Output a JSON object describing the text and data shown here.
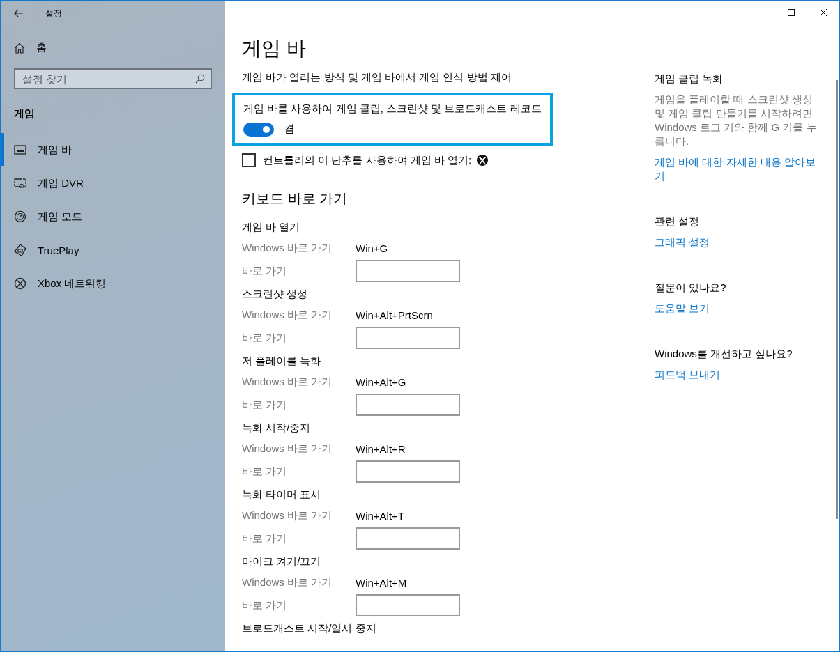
{
  "window": {
    "title": "설정"
  },
  "sidebar": {
    "home": "홈",
    "search": {
      "placeholder": "설정 찾기"
    },
    "section": "게임",
    "items": [
      {
        "label": "게임 바",
        "selected": true
      },
      {
        "label": "게임 DVR",
        "selected": false
      },
      {
        "label": "게임 모드",
        "selected": false
      },
      {
        "label": "TruePlay",
        "selected": false
      },
      {
        "label": "Xbox 네트워킹",
        "selected": false
      }
    ]
  },
  "main": {
    "title": "게임 바",
    "description": "게임 바가 열리는 방식 및 게임 바에서 게임 인식 방법 제어",
    "toggle": {
      "label": "게임 바를 사용하여 게임 클립, 스크린샷 및 브로드캐스트 레코드",
      "on": true,
      "state_text": "켬",
      "focused": true
    },
    "checkbox": {
      "label": "컨트롤러의 이 단추를 사용하여 게임 바 열기:",
      "checked": false
    },
    "shortcuts_title": "키보드 바로 가기",
    "shortcuts": [
      {
        "heading": "게임 바 열기",
        "windows_label": "Windows 바로 가기",
        "windows_value": "Win+G",
        "custom_label": "바로 가기"
      },
      {
        "heading": "스크린샷 생성",
        "windows_label": "Windows 바로 가기",
        "windows_value": "Win+Alt+PrtScrn",
        "custom_label": "바로 가기"
      },
      {
        "heading": "저 플레이를 녹화",
        "windows_label": "Windows 바로 가기",
        "windows_value": "Win+Alt+G",
        "custom_label": "바로 가기"
      },
      {
        "heading": "녹화 시작/중지",
        "windows_label": "Windows 바로 가기",
        "windows_value": "Win+Alt+R",
        "custom_label": "바로 가기"
      },
      {
        "heading": "녹화 타이머 표시",
        "windows_label": "Windows 바로 가기",
        "windows_value": "Win+Alt+T",
        "custom_label": "바로 가기"
      },
      {
        "heading": "마이크 켜기/끄기",
        "windows_label": "Windows 바로 가기",
        "windows_value": "Win+Alt+M",
        "custom_label": "바로 가기"
      },
      {
        "heading": "브로드캐스트 시작/일시 중지"
      }
    ]
  },
  "aside": [
    {
      "heading": "게임 클립 녹화",
      "text": "게임을 플레이할 때 스크린샷 생성 및 게임 클립 만들기를 시작하려면 Windows 로고 키와 함께 G 키를 누릅니다.",
      "link": "게임 바에 대한 자세한 내용 알아보기"
    },
    {
      "heading": "관련 설정",
      "link": "그래픽 설정"
    },
    {
      "heading": "질문이 있나요?",
      "link": "도움말 보기"
    },
    {
      "heading": "Windows를 개선하고 싶나요?",
      "link": "피드백 보내기"
    }
  ]
}
